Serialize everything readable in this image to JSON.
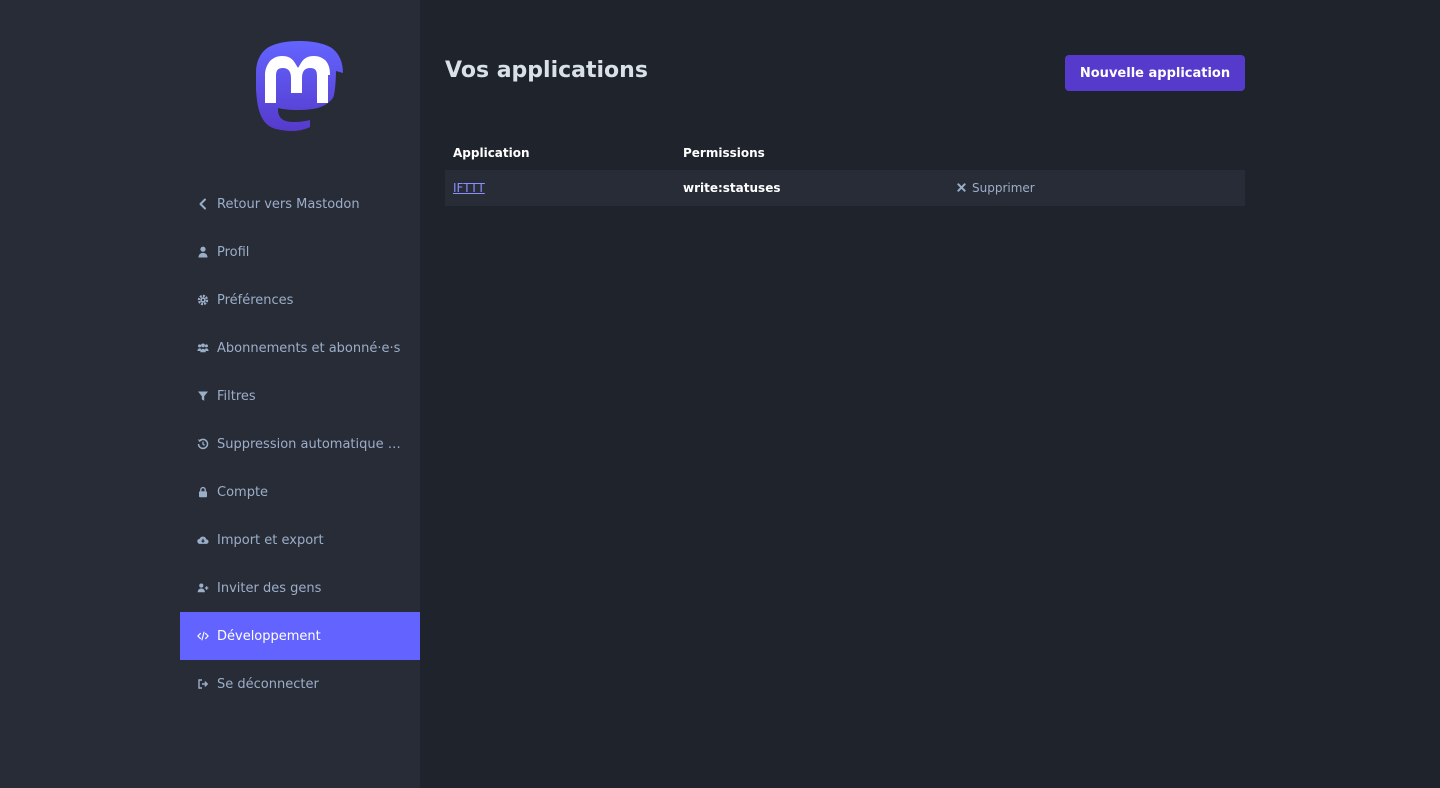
{
  "sidebar": {
    "logo": "mastodon-logo",
    "items": [
      {
        "label": "Retour vers Mastodon",
        "icon": "chevron-left-icon"
      },
      {
        "label": "Profil",
        "icon": "user-icon"
      },
      {
        "label": "Préférences",
        "icon": "gear-icon"
      },
      {
        "label": "Abonnements et abonné·e·s",
        "icon": "users-icon"
      },
      {
        "label": "Filtres",
        "icon": "filter-icon"
      },
      {
        "label": "Suppression automatique de …",
        "icon": "history-icon"
      },
      {
        "label": "Compte",
        "icon": "lock-icon"
      },
      {
        "label": "Import et export",
        "icon": "cloud-download-icon"
      },
      {
        "label": "Inviter des gens",
        "icon": "user-plus-icon"
      },
      {
        "label": "Développement",
        "icon": "code-icon",
        "active": true
      },
      {
        "label": "Se déconnecter",
        "icon": "sign-out-icon"
      }
    ]
  },
  "main": {
    "title": "Vos applications",
    "new_app_label": "Nouvelle application",
    "table": {
      "headers": [
        "Application",
        "Permissions",
        ""
      ],
      "rows": [
        {
          "application": "IFTTT",
          "permissions": "write:statuses",
          "action": "Supprimer"
        }
      ]
    }
  },
  "colors": {
    "accent": "#6364ff",
    "button": "#563acc",
    "sidebar_bg": "#282c37",
    "page_bg": "#1f232b"
  }
}
